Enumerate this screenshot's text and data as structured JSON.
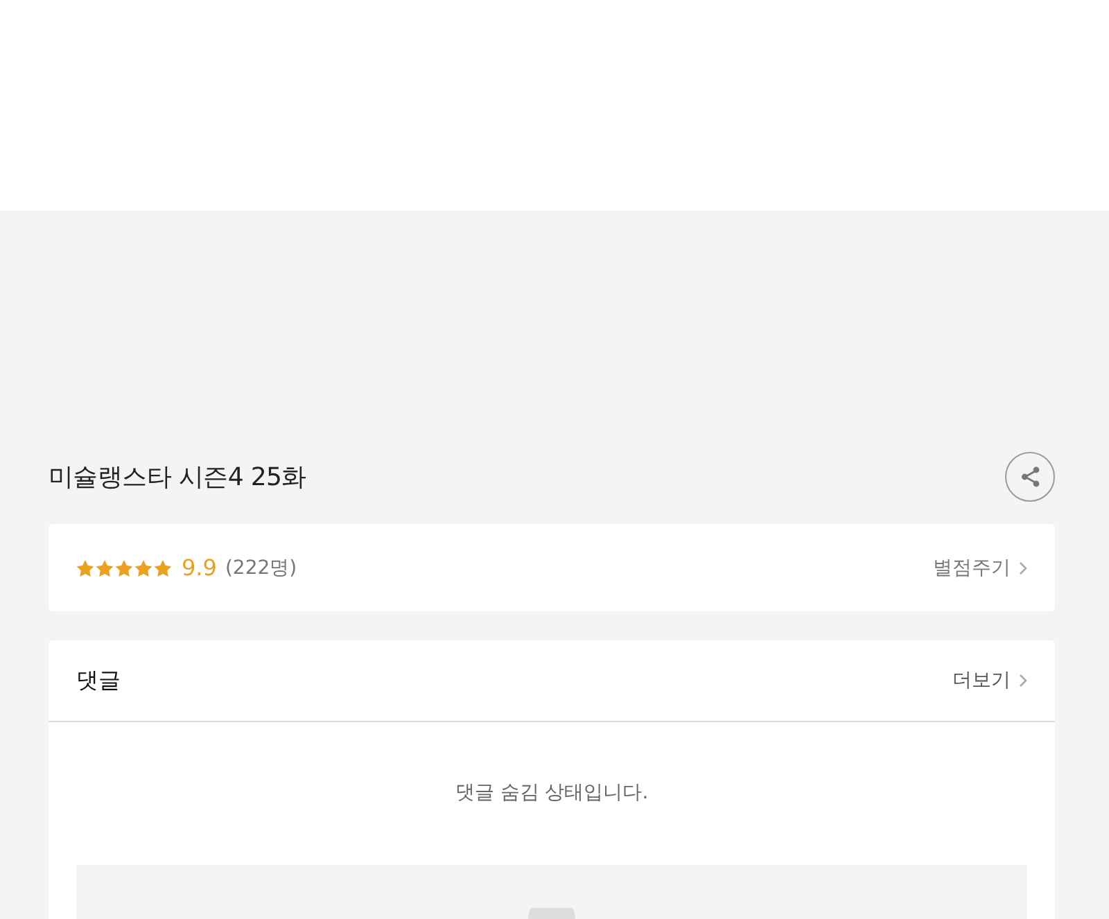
{
  "episode": {
    "title": "미슐랭스타 시즌4 25화"
  },
  "rating": {
    "stars": 5,
    "score": "9.9",
    "count": "(222명)",
    "action": "별점주기"
  },
  "comments": {
    "title": "댓글",
    "more": "더보기",
    "message": "댓글 숨김 상태입니다."
  }
}
